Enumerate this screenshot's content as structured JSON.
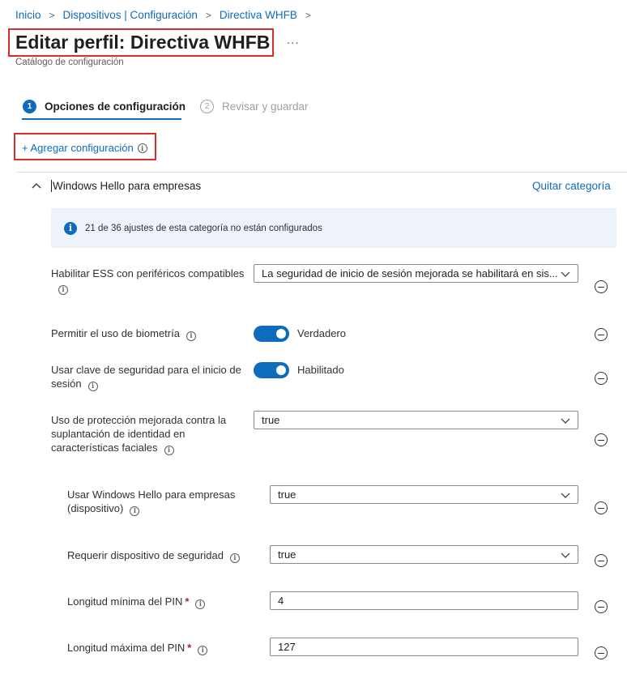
{
  "breadcrumb": [
    "Inicio",
    "Dispositivos | Configuración",
    "Directiva WHFB"
  ],
  "page": {
    "title": "Editar perfil: Directiva WHFB",
    "more": "...",
    "subtitle": "Catálogo de configuración"
  },
  "steps": [
    {
      "number": "1",
      "label": "Opciones de configuración",
      "active": true
    },
    {
      "number": "2",
      "label": "Revisar y guardar",
      "active": false
    }
  ],
  "add_setting": "+ Agregar configuración",
  "category": {
    "title": "Windows Hello para empresas",
    "remove": "Quitar categoría",
    "banner": "21 de 36 ajustes de esta categoría no están configurados"
  },
  "settings": {
    "ess": {
      "label": "Habilitar ESS con periféricos compatibles",
      "value": "La seguridad de inicio de sesión mejorada se habilitará en sis..."
    },
    "biometrics": {
      "label": "Permitir el uso de biometría",
      "value": "Verdadero",
      "on": true
    },
    "security_key": {
      "label": "Usar clave de seguridad para el inicio de sesión",
      "value": "Habilitado",
      "on": true
    },
    "anti_spoof": {
      "label": "Uso de protección mejorada contra la suplantación de identidad en características faciales",
      "value": "true"
    },
    "use_whfb": {
      "label": "Usar Windows Hello para empresas (dispositivo)",
      "value": "true"
    },
    "require_device": {
      "label": "Requerir dispositivo de seguridad",
      "value": "true"
    },
    "min_pin": {
      "label": "Longitud mínima del PIN",
      "required": "*",
      "value": "4"
    },
    "max_pin": {
      "label": "Longitud máxima del PIN",
      "required": "*",
      "value": "127"
    }
  },
  "colors": {
    "accent": "#0f6cbd",
    "highlight": "#d32f2f",
    "banner": "#eef3fb"
  },
  "icons": [
    "chevron-right-icon",
    "more-icon",
    "info-icon",
    "chevron-up-icon",
    "chevron-down-icon",
    "remove-circle-icon"
  ]
}
